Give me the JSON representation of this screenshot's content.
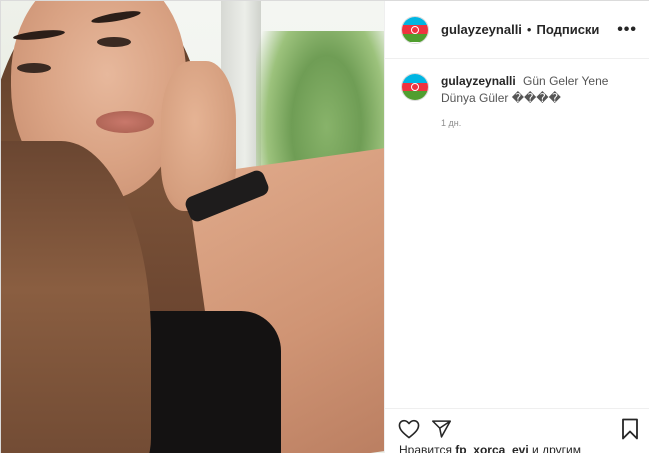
{
  "post": {
    "username": "gulayzeynalli",
    "separator": "•",
    "follow_label": "Подписки",
    "more_label": "•••",
    "caption_username": "gulayzeynalli",
    "caption_text": "Gün Geler Yene Dünya Güler ����",
    "time_ago": "1 дн.",
    "likes_prefix": "Нравится",
    "likes_user": "fp_xorca_evi",
    "likes_suffix": "и другим"
  },
  "icons": {
    "avatar": "azerbaijan-flag-avatar",
    "like": "heart-icon",
    "share": "send-icon",
    "save": "bookmark-icon",
    "more": "more-options-icon"
  },
  "colors": {
    "text": "#262626",
    "muted": "#8e8e8e",
    "border": "#dbdbdb"
  }
}
